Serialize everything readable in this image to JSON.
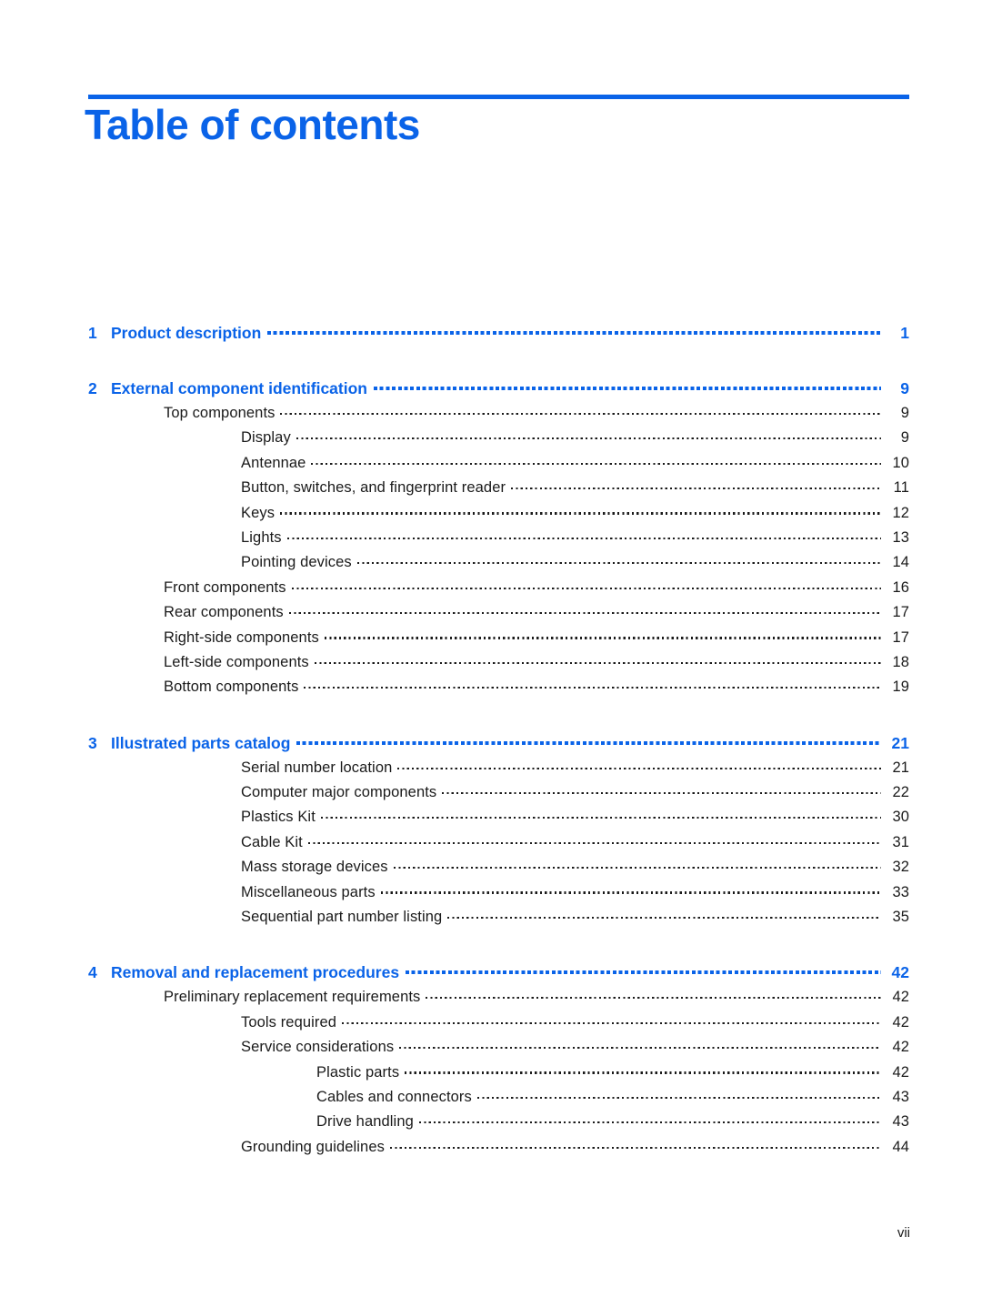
{
  "document": {
    "title": "Table of contents",
    "accent_color": "#0A63E8",
    "text_color": "#1a1a1a",
    "footer_page_label": "vii"
  },
  "toc": {
    "rows": [
      {
        "kind": "chapter",
        "number": "1",
        "title": "Product description",
        "page": "1"
      },
      {
        "kind": "chapter",
        "number": "2",
        "title": "External component identification",
        "page": "9"
      },
      {
        "kind": "entry",
        "level": 1,
        "title": "Top components",
        "page": "9"
      },
      {
        "kind": "entry",
        "level": 2,
        "title": "Display",
        "page": "9"
      },
      {
        "kind": "entry",
        "level": 2,
        "title": "Antennae",
        "page": "10"
      },
      {
        "kind": "entry",
        "level": 2,
        "title": "Button, switches, and fingerprint reader",
        "page": "11"
      },
      {
        "kind": "entry",
        "level": 2,
        "title": "Keys",
        "page": "12"
      },
      {
        "kind": "entry",
        "level": 2,
        "title": "Lights",
        "page": "13"
      },
      {
        "kind": "entry",
        "level": 2,
        "title": "Pointing devices",
        "page": "14"
      },
      {
        "kind": "entry",
        "level": 1,
        "title": "Front components",
        "page": "16"
      },
      {
        "kind": "entry",
        "level": 1,
        "title": "Rear components",
        "page": "17"
      },
      {
        "kind": "entry",
        "level": 1,
        "title": "Right-side components",
        "page": "17"
      },
      {
        "kind": "entry",
        "level": 1,
        "title": "Left-side components",
        "page": "18"
      },
      {
        "kind": "entry",
        "level": 1,
        "title": "Bottom components",
        "page": "19"
      },
      {
        "kind": "chapter",
        "number": "3",
        "title": "Illustrated parts catalog",
        "page": "21"
      },
      {
        "kind": "entry",
        "level": 2,
        "title": "Serial number location",
        "page": "21"
      },
      {
        "kind": "entry",
        "level": 2,
        "title": "Computer major components",
        "page": "22"
      },
      {
        "kind": "entry",
        "level": 2,
        "title": "Plastics Kit",
        "page": "30"
      },
      {
        "kind": "entry",
        "level": 2,
        "title": "Cable Kit",
        "page": "31"
      },
      {
        "kind": "entry",
        "level": 2,
        "title": "Mass storage devices",
        "page": "32"
      },
      {
        "kind": "entry",
        "level": 2,
        "title": "Miscellaneous parts",
        "page": "33"
      },
      {
        "kind": "entry",
        "level": 2,
        "title": "Sequential part number listing",
        "page": "35"
      },
      {
        "kind": "chapter",
        "number": "4",
        "title": "Removal and replacement procedures",
        "page": "42"
      },
      {
        "kind": "entry",
        "level": 1,
        "title": "Preliminary replacement requirements",
        "page": "42"
      },
      {
        "kind": "entry",
        "level": 2,
        "title": "Tools required",
        "page": "42"
      },
      {
        "kind": "entry",
        "level": 2,
        "title": "Service considerations",
        "page": "42"
      },
      {
        "kind": "entry",
        "level": 3,
        "title": "Plastic parts",
        "page": "42"
      },
      {
        "kind": "entry",
        "level": 3,
        "title": "Cables and connectors",
        "page": "43"
      },
      {
        "kind": "entry",
        "level": 3,
        "title": "Drive handling",
        "page": "43"
      },
      {
        "kind": "entry",
        "level": 2,
        "title": "Grounding guidelines",
        "page": "44"
      }
    ]
  }
}
